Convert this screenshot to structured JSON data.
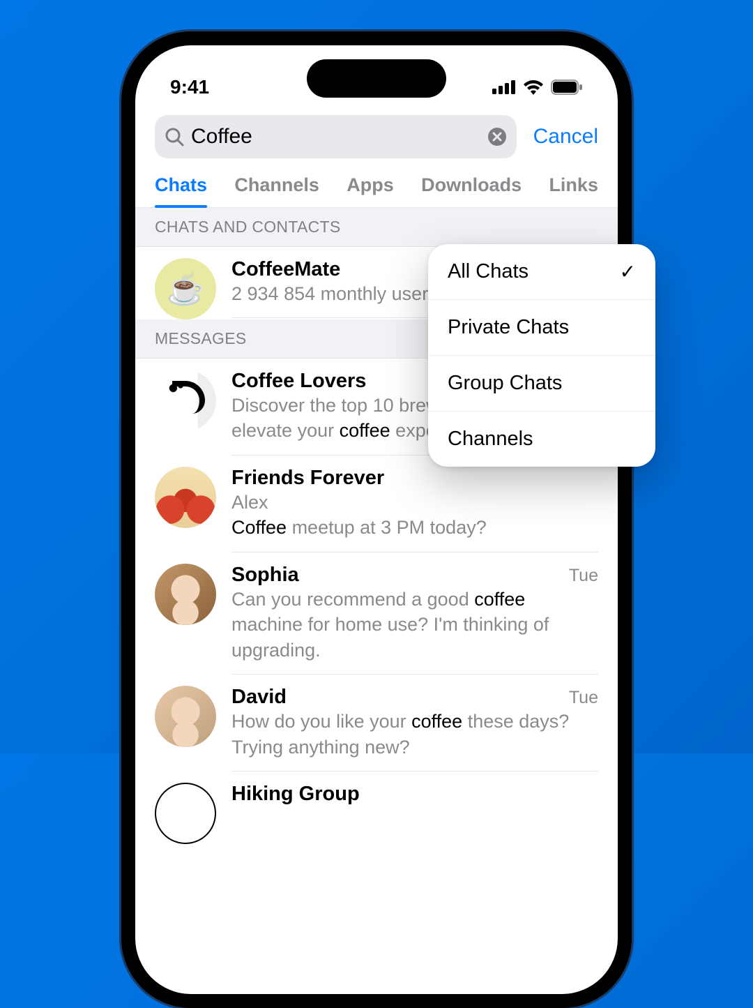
{
  "status": {
    "time": "9:41"
  },
  "search": {
    "value": "Coffee",
    "cancel": "Cancel"
  },
  "tabs": [
    "Chats",
    "Channels",
    "Apps",
    "Downloads",
    "Links"
  ],
  "active_tab": 0,
  "sections": {
    "contacts_header": "CHATS AND CONTACTS",
    "messages_header": "MESSAGES"
  },
  "contacts": [
    {
      "name": "CoffeeMate",
      "sub": "2 934 854 monthly users"
    }
  ],
  "messages": [
    {
      "name": "Coffee Lovers",
      "sub_pre": "Discover the top 10 brewing methods to elevate your ",
      "sub_kw": "coffee",
      "sub_post": " experience",
      "ts": ""
    },
    {
      "name": "Friends Forever",
      "sender": "Alex",
      "sub_pre": "",
      "sub_kw": "Coffee",
      "sub_post": " meetup at 3 PM today?",
      "ts": ""
    },
    {
      "name": "Sophia",
      "sub_pre": "Can you recommend a good ",
      "sub_kw": "coffee",
      "sub_post": " machine for home use? I'm thinking of upgrading.",
      "ts": "Tue"
    },
    {
      "name": "David",
      "sub_pre": "How do you like your ",
      "sub_kw": "coffee",
      "sub_post": " these days? Trying anything new?",
      "ts": "Tue"
    },
    {
      "name": "Hiking Group",
      "sub_pre": "…",
      "sub_kw": "",
      "sub_post": "",
      "ts": ""
    }
  ],
  "popover": {
    "selected": 0,
    "items": [
      "All Chats",
      "Private Chats",
      "Group Chats",
      "Channels"
    ]
  }
}
